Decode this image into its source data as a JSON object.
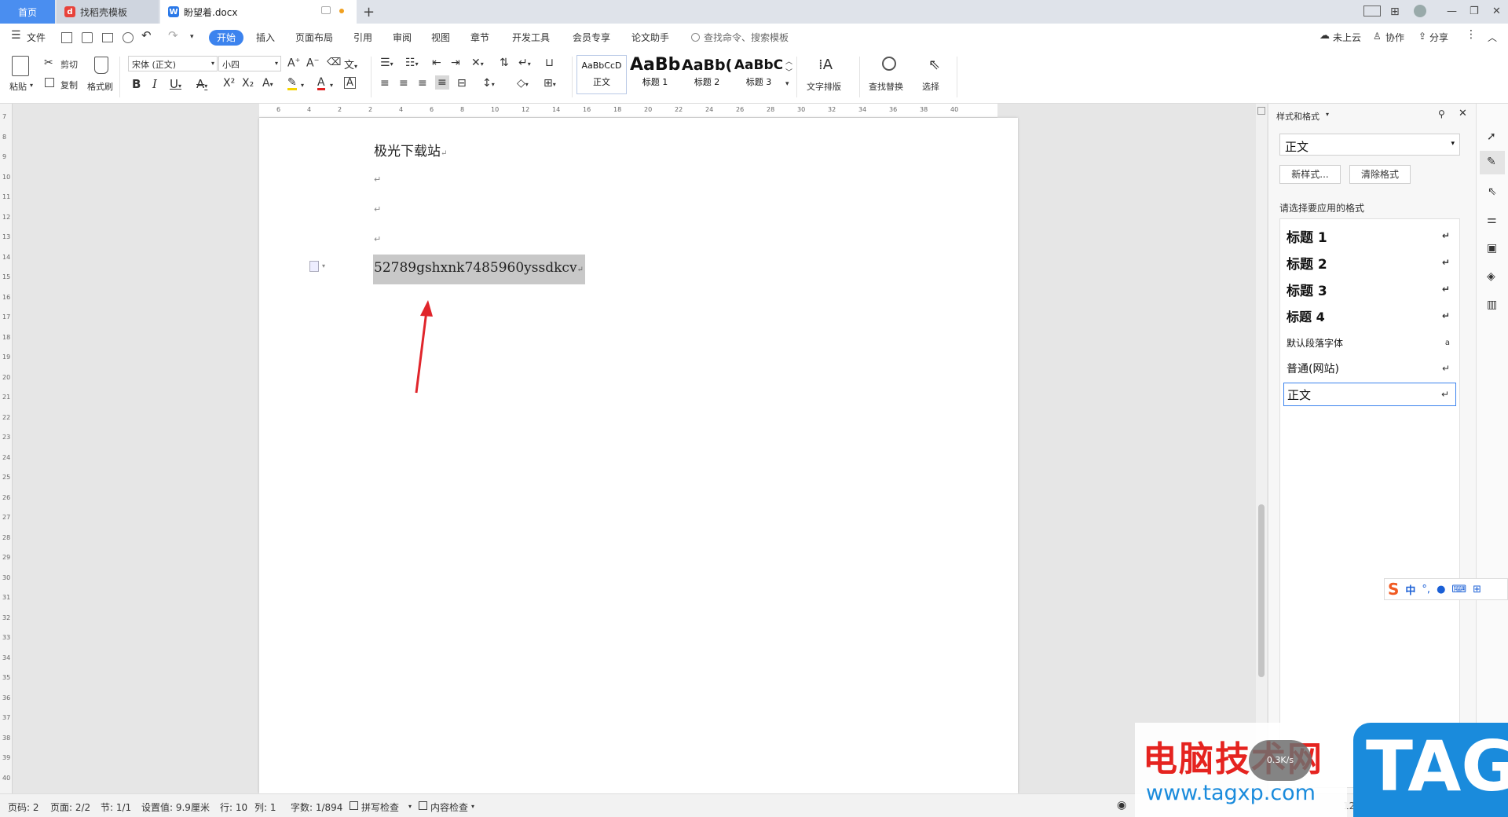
{
  "tabs": {
    "home": "首页",
    "template": "找稻壳模板",
    "doc": "盼望着.docx",
    "new_tab": "+"
  },
  "menu": {
    "file": "文件",
    "items": [
      "开始",
      "插入",
      "页面布局",
      "引用",
      "审阅",
      "视图",
      "章节",
      "开发工具",
      "会员专享",
      "论文助手"
    ],
    "search": "查找命令、搜索模板",
    "cloud": "未上云",
    "collab": "协作",
    "share": "分享"
  },
  "ribbon": {
    "paste": "粘贴",
    "cut": "剪切",
    "copy": "复制",
    "format_painter": "格式刷",
    "font_name": "宋体 (正文)",
    "font_size": "小四",
    "styles": [
      {
        "preview": "AaBbCcD",
        "label": "正文"
      },
      {
        "preview": "AaBb",
        "label": "标题 1"
      },
      {
        "preview": "AaBb(",
        "label": "标题 2"
      },
      {
        "preview": "AaBbC",
        "label": "标题 3"
      }
    ],
    "text_layout": "文字排版",
    "find_replace": "查找替换",
    "select": "选择"
  },
  "ruler": {
    "h_ticks": [
      "6",
      "4",
      "2",
      "2",
      "4",
      "6",
      "8",
      "10",
      "12",
      "14",
      "16",
      "18",
      "20",
      "22",
      "24",
      "26",
      "28",
      "30",
      "32",
      "34",
      "36",
      "38",
      "40"
    ],
    "v_ticks": [
      "7",
      "8",
      "9",
      "10",
      "11",
      "12",
      "13",
      "14",
      "15",
      "16",
      "17",
      "18",
      "19",
      "20",
      "21",
      "22",
      "23",
      "24",
      "25",
      "26",
      "27",
      "28",
      "29",
      "30",
      "31",
      "32",
      "33",
      "34",
      "35",
      "36",
      "37",
      "38",
      "39",
      "40"
    ]
  },
  "document": {
    "line1": "极光下载站",
    "selected_text": "52789gshxnk7485960yssdkcv",
    "para_mark": "↵"
  },
  "styles_panel": {
    "title": "样式和格式",
    "current_style": "正文",
    "new_style": "新样式...",
    "clear_format": "清除格式",
    "prompt": "请选择要应用的格式",
    "items": [
      {
        "name": "标题  1",
        "mark": "↵"
      },
      {
        "name": "标题  2",
        "mark": "↵"
      },
      {
        "name": "标题  3",
        "mark": "↵"
      },
      {
        "name": "标题  4",
        "mark": "↵"
      },
      {
        "name": "默认段落字体",
        "mark": "a"
      },
      {
        "name": "普通(网站)",
        "mark": "↵"
      },
      {
        "name": "正文",
        "mark": "↵"
      }
    ]
  },
  "ime": {
    "lang": "中"
  },
  "status": {
    "page_no": "页码: 2",
    "pages": "页面: 2/2",
    "section": "节: 1/1",
    "setting": "设置值: 9.9厘米",
    "row": "行: 10",
    "col": "列: 1",
    "words": "字数: 1/894",
    "spell": "拼写检查",
    "content_check": "内容检查",
    "zoom": "122%"
  },
  "watermark": {
    "site_name": "电脑技术网",
    "url": "www.tagxp.com",
    "logo": "TAG",
    "badge": "0.3K/s"
  },
  "colors": {
    "accent": "#3c83ee",
    "selection": "#c8c8c8",
    "arrow": "#e0252b",
    "watermark_red": "#e5231f",
    "tag_blue": "#1a8bdc"
  }
}
